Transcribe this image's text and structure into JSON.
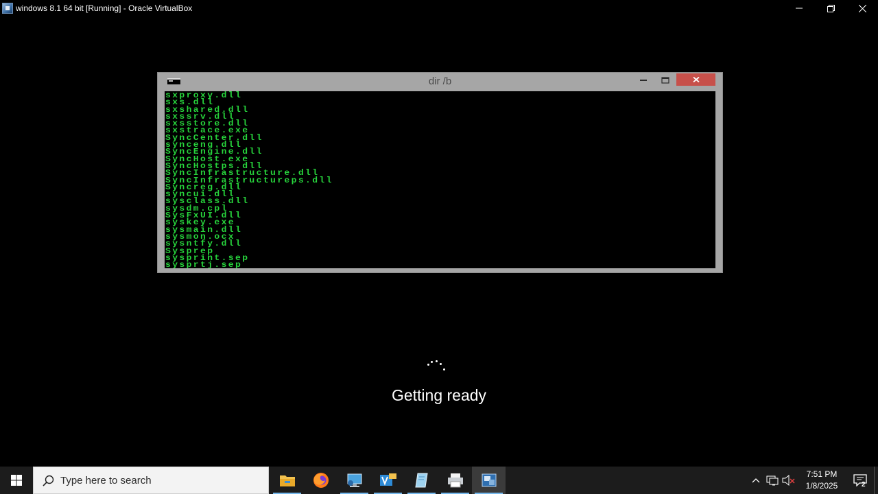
{
  "host": {
    "title": "windows 8.1 64 bit [Running] - Oracle VirtualBox",
    "icon": "virtualbox-icon",
    "controls": [
      "minimize-icon",
      "restore-icon",
      "close-icon"
    ]
  },
  "console": {
    "title": "dir /b",
    "text_color": "#27d43c",
    "close_color": "#c7504a",
    "lines": [
      "sxproxy.dll",
      "sxs.dll",
      "sxshared.dll",
      "sxssrv.dll",
      "sxsstore.dll",
      "sxstrace.exe",
      "SyncCenter.dll",
      "synceng.dll",
      "SyncEngine.dll",
      "SyncHost.exe",
      "SyncHostps.dll",
      "SyncInfrastructure.dll",
      "SyncInfrastructureps.dll",
      "Syncreg.dll",
      "syncui.dll",
      "sysclass.dll",
      "sysdm.cpl",
      "SysFxUI.dll",
      "syskey.exe",
      "sysmain.dll",
      "sysmon.ocx",
      "sysntfy.dll",
      "Sysprep",
      "sysprint.sep",
      "sysprtj.sep"
    ]
  },
  "loading": {
    "status": "Getting ready"
  },
  "taskbar": {
    "search_placeholder": "Type here to search",
    "apps": [
      {
        "name": "file-explorer-icon",
        "running": true
      },
      {
        "name": "firefox-icon",
        "running": false
      },
      {
        "name": "remote-desktop-icon",
        "running": true
      },
      {
        "name": "visual-studio-icon",
        "running": true
      },
      {
        "name": "notepad-icon",
        "running": true
      },
      {
        "name": "printer-app-icon",
        "running": true
      },
      {
        "name": "virtualbox-taskbar-icon",
        "running": true,
        "active": true
      }
    ],
    "tray": {
      "icons": [
        "chevron-up-icon",
        "network-icon",
        "volume-muted-icon"
      ],
      "time": "7:51 PM",
      "date": "1/8/2025",
      "notification_count": "2"
    }
  }
}
